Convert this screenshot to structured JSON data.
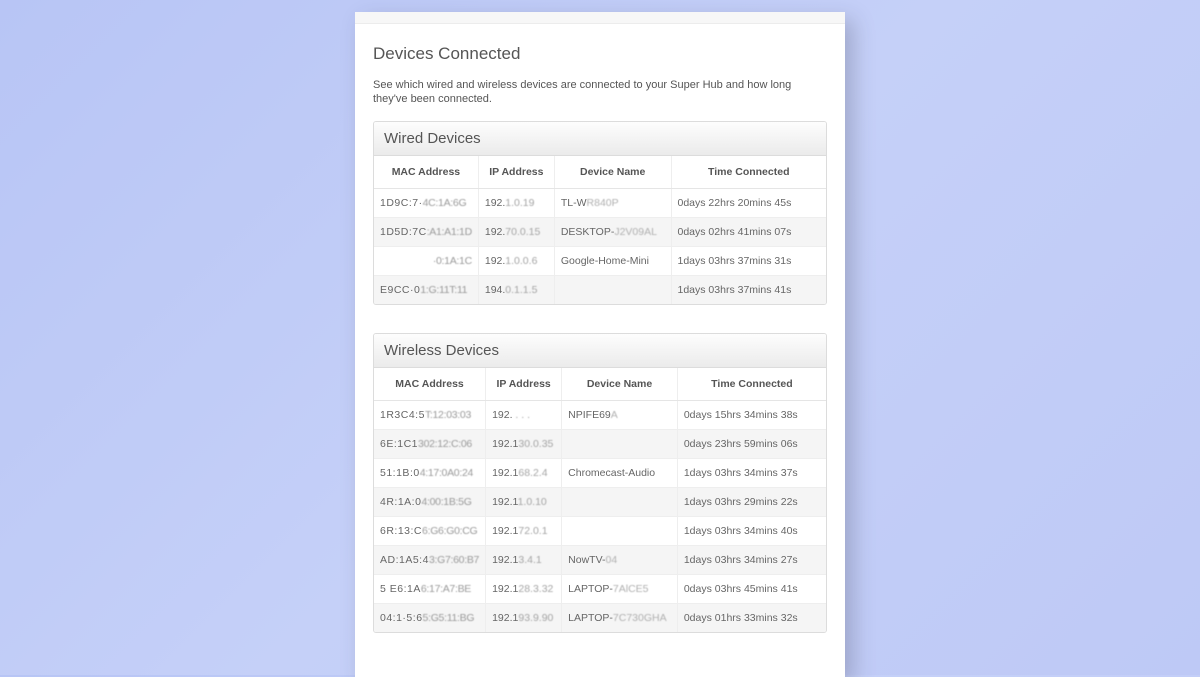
{
  "page": {
    "title": "Devices Connected",
    "intro": "See which wired and wireless devices are connected to your Super Hub and how long they've been connected."
  },
  "tables": {
    "wired": {
      "title": "Wired Devices",
      "columns": [
        "MAC Address",
        "IP Address",
        "Device Name",
        "Time Connected"
      ],
      "rows": [
        {
          "mac_prefix": "1D9C:7·",
          "mac_scramble": "4C:1A:6G",
          "ip_prefix": "192.",
          "ip_scramble": "1.0.19",
          "name": "TL-W",
          "name_scramble": "R840P",
          "time": "0days 22hrs 20mins 45s"
        },
        {
          "mac_prefix": "1D5D:7C",
          "mac_scramble": ":A1:A1:1D",
          "ip_prefix": "192.",
          "ip_scramble": "70.0.15",
          "name": "DESKTOP-",
          "name_scramble": "J2V09AL",
          "time": "0days 02hrs 41mins 07s"
        },
        {
          "mac_prefix": "",
          "mac_scramble": "·0:1A:1C",
          "ip_prefix": "192.",
          "ip_scramble": "1.0.0.6",
          "name": "Google-Home-Mini",
          "name_scramble": "",
          "time": "1days 03hrs 37mins 31s"
        },
        {
          "mac_prefix": "E9CC·0",
          "mac_scramble": "1:G:11T:11",
          "ip_prefix": "194.",
          "ip_scramble": "0.1.1.5",
          "name": "",
          "name_scramble": "",
          "time": "1days 03hrs 37mins 41s"
        }
      ]
    },
    "wireless": {
      "title": "Wireless Devices",
      "columns": [
        "MAC Address",
        "IP Address",
        "Device Name",
        "Time Connected"
      ],
      "rows": [
        {
          "mac_prefix": "1R3C4:5",
          "mac_scramble": "T:12:03:03",
          "ip_prefix": "192.",
          "ip_scramble": "  . . .",
          "name": "NPIFE69",
          "name_scramble": "A",
          "time": "0days 15hrs 34mins 38s"
        },
        {
          "mac_prefix": "6E:1C1",
          "mac_scramble": "302:12:C:06",
          "ip_prefix": "192.1",
          "ip_scramble": "30.0.35",
          "name": "",
          "name_scramble": "",
          "time": "0days 23hrs 59mins 06s"
        },
        {
          "mac_prefix": "51:1B:0",
          "mac_scramble": "4:17:0A0:24",
          "ip_prefix": "192.1",
          "ip_scramble": "68.2.4",
          "name": "Chromecast-Audio",
          "name_scramble": "",
          "time": "1days 03hrs 34mins 37s"
        },
        {
          "mac_prefix": "4R:1A:0",
          "mac_scramble": "4:00:1B:5G",
          "ip_prefix": "192.1",
          "ip_scramble": "1.0.10",
          "name": "",
          "name_scramble": "",
          "time": "1days 03hrs 29mins 22s"
        },
        {
          "mac_prefix": "6R:13:C",
          "mac_scramble": "6:G6:G0:CG",
          "ip_prefix": "192.1",
          "ip_scramble": "72.0.1",
          "name": "",
          "name_scramble": "",
          "time": "1days 03hrs 34mins 40s"
        },
        {
          "mac_prefix": "AD:1A5:4",
          "mac_scramble": "3:G7:60:B7",
          "ip_prefix": "192.1",
          "ip_scramble": "3.4.1",
          "name": "NowTV-",
          "name_scramble": "04",
          "time": "1days 03hrs 34mins 27s"
        },
        {
          "mac_prefix": "5 E6:1A",
          "mac_scramble": "6:17:A7:BE",
          "ip_prefix": "192.1",
          "ip_scramble": "28.3.32",
          "name": "LAPTOP-",
          "name_scramble": "7AlCE5",
          "time": "0days 03hrs 45mins 41s"
        },
        {
          "mac_prefix": "04:1·5:6",
          "mac_scramble": "5:G5:11:BG",
          "ip_prefix": "192.1",
          "ip_scramble": "93.9.90",
          "name": "LAPTOP-",
          "name_scramble": "7C730GHA",
          "time": "0days 01hrs 33mins 32s"
        }
      ]
    }
  }
}
